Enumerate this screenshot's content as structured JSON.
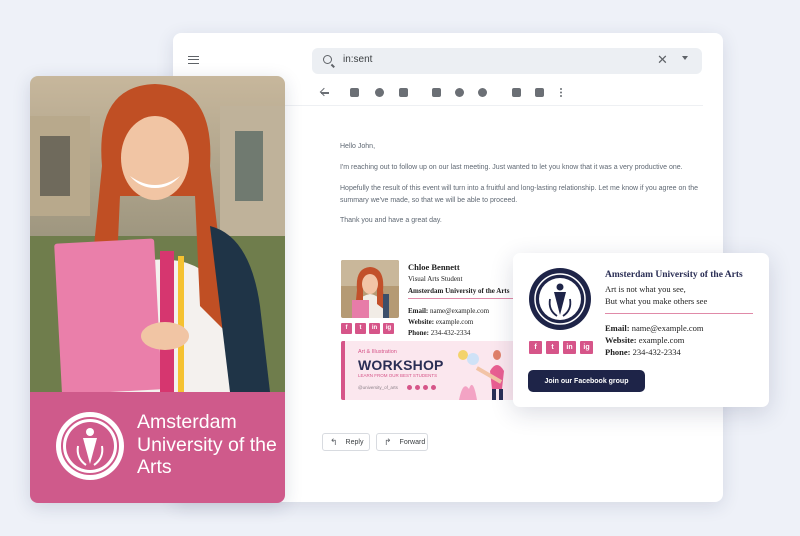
{
  "app": {
    "search_query": "in:sent",
    "clear_glyph": "✕"
  },
  "message": {
    "greeting": "Hello John,",
    "para1": "I'm reaching out to follow up on our last meeting. Just wanted to let you know that it was a very productive one.",
    "para2": "Hopefully the result of this event will turn into a fruitful and long-lasting relationship. Let me know if you agree on the summary we've made, so that we will be able to proceed.",
    "closing": "Thank you and have a great day."
  },
  "signature": {
    "name": "Chloe Bennett",
    "title": "Visual Arts Student",
    "org": "Amsterdam University of the Arts",
    "email_label": "Email:",
    "email": "name@example.com",
    "website_label": "Website:",
    "website": "example.com",
    "phone_label": "Phone:",
    "phone": "234-432-2334",
    "social": [
      "f",
      "t",
      "in",
      "ig"
    ]
  },
  "banner": {
    "kicker": "Art & Illustration",
    "headline": "WORKSHOP",
    "subline": "LEARN FROM OUR BEST STUDENTS",
    "handle": "@university_of_arts"
  },
  "actions": {
    "reply": "Reply",
    "forward": "Forward"
  },
  "photo_card": {
    "university": "Amsterdam University of the Arts"
  },
  "popup": {
    "name": "Amsterdam University of the Arts",
    "line1": "Art is not what you see,",
    "line2": "But what you make others see",
    "email_label": "Email:",
    "email": "name@example.com",
    "website_label": "Website:",
    "website": "example.com",
    "phone_label": "Phone:",
    "phone": "234-432-2334",
    "button": "Join our Facebook group"
  },
  "colors": {
    "brand_pink": "#cf5a8b",
    "navy": "#1e2448",
    "background": "#eef1f8"
  },
  "icons": [
    "menu-icon",
    "search-icon",
    "close-icon",
    "dropdown-icon",
    "back-icon",
    "archive-icon",
    "report-icon",
    "delete-icon",
    "mark-unread-icon",
    "snooze-icon",
    "add-task-icon",
    "move-to-icon",
    "label-icon",
    "more-icon",
    "reply-icon",
    "forward-icon"
  ]
}
